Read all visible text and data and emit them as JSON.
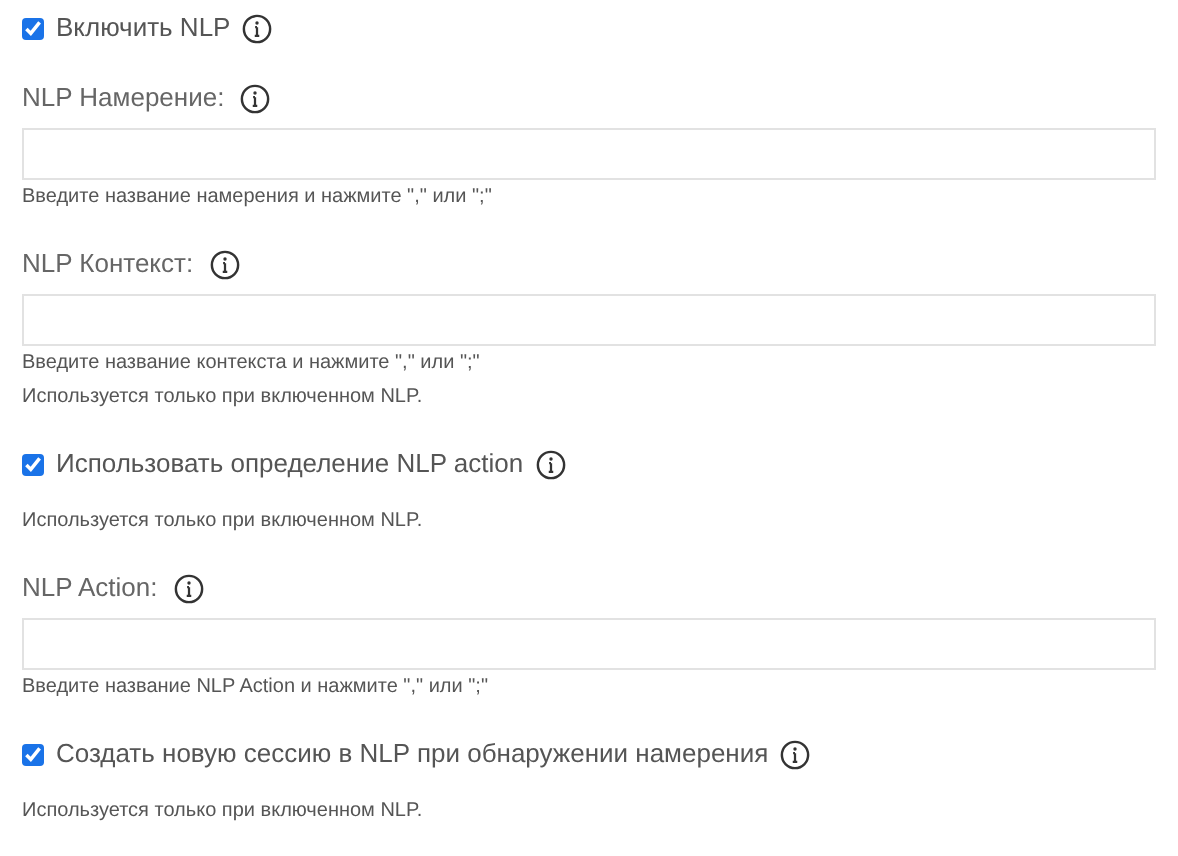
{
  "items": [
    {
      "kind": "checkbox",
      "label": "Включить NLP",
      "checked": true
    },
    {
      "kind": "field",
      "label": "NLP Намерение:",
      "hints": [
        "Введите название намерения и нажмите \",\" или \";\""
      ]
    },
    {
      "kind": "field",
      "label": "NLP Контекст:",
      "hints": [
        "Введите название контекста и нажмите \",\" или \";\"",
        "Используется только при включенном NLP."
      ]
    },
    {
      "kind": "checkbox",
      "label": "Использовать определение NLP action",
      "checked": true,
      "hints": [
        "Используется только при включенном NLP."
      ]
    },
    {
      "kind": "field",
      "label": "NLP Action:",
      "hints": [
        "Введите название NLP Action и нажмите \",\" или \";\""
      ]
    },
    {
      "kind": "checkbox",
      "label": "Создать новую сессию в NLP при обнаружении намерения",
      "checked": true,
      "hints": [
        "Используется только при включенном NLP."
      ]
    }
  ]
}
